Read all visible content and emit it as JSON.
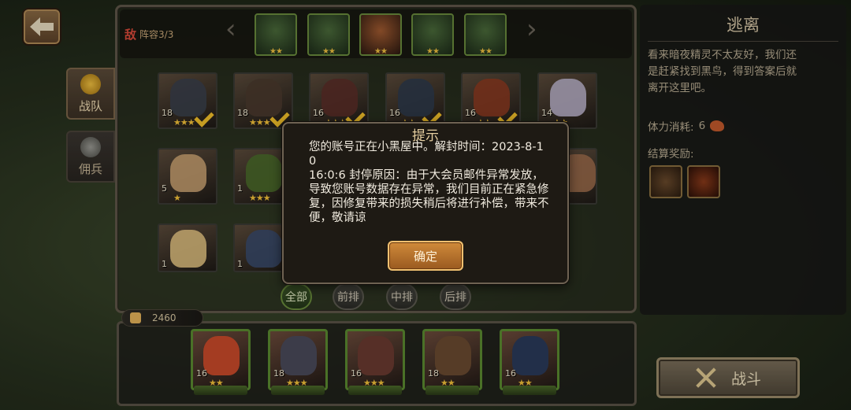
{
  "header": {
    "enemy_badge": "敌",
    "lineup_label": "阵容3/3"
  },
  "tabs": [
    {
      "label": "战队",
      "icon": "helmet-gold-icon",
      "active": true
    },
    {
      "label": "佣兵",
      "icon": "helmet-gray-icon",
      "active": false
    }
  ],
  "hero_grid": [
    {
      "level": "18",
      "stars": "★★★",
      "selected": true,
      "color": "#3a3f4a"
    },
    {
      "level": "18",
      "stars": "★★★",
      "selected": true,
      "color": "#4a3a2e"
    },
    {
      "level": "16",
      "stars": "★★★",
      "selected": true,
      "color": "#5a2e28"
    },
    {
      "level": "16",
      "stars": "★★",
      "selected": true,
      "color": "#2e3a4a"
    },
    {
      "level": "16",
      "stars": "★★",
      "selected": true,
      "color": "#8a3a20"
    },
    {
      "level": "14",
      "stars": "★★",
      "selected": false,
      "color": "#b8b0c8"
    },
    {
      "level": "5",
      "stars": "★",
      "selected": false,
      "color": "#c8a070"
    },
    {
      "level": "1",
      "stars": "★★★",
      "selected": false,
      "color": "#4a6a2a"
    },
    {
      "level": "1",
      "stars": "★",
      "selected": false,
      "color": "#e0c080"
    },
    {
      "level": "1",
      "stars": "★",
      "selected": false,
      "color": "#3a4a6a"
    }
  ],
  "filters": [
    "全部",
    "前排",
    "中排",
    "后排"
  ],
  "power": "2460",
  "team": [
    {
      "level": "16",
      "stars": "★★",
      "color": "#c84a2a"
    },
    {
      "level": "18",
      "stars": "★★★",
      "color": "#4a4a5a"
    },
    {
      "level": "16",
      "stars": "★★★",
      "color": "#6a3a30"
    },
    {
      "level": "18",
      "stars": "★★",
      "color": "#6a4a30"
    },
    {
      "level": "16",
      "stars": "★★",
      "color": "#2a3a5a"
    }
  ],
  "right": {
    "title": "逃离",
    "description": "看来暗夜精灵不太友好，我们还是赶紧找到黑鸟，得到答案后就离开这里吧。",
    "stamina_label": "体力消耗:",
    "stamina_value": "6",
    "reward_label": "结算奖励:",
    "fight_label": "战斗"
  },
  "modal": {
    "title": "提示",
    "body": "您的账号正在小黑屋中。解封时间：2023-8-10\n16:0:6 封停原因：由于大会员邮件异常发放，导致您账号数据存在异常，我们目前正在紧急修复，因修复带来的损失稍后将进行补偿，带来不便，敬请谅",
    "ok_label": "确定"
  }
}
